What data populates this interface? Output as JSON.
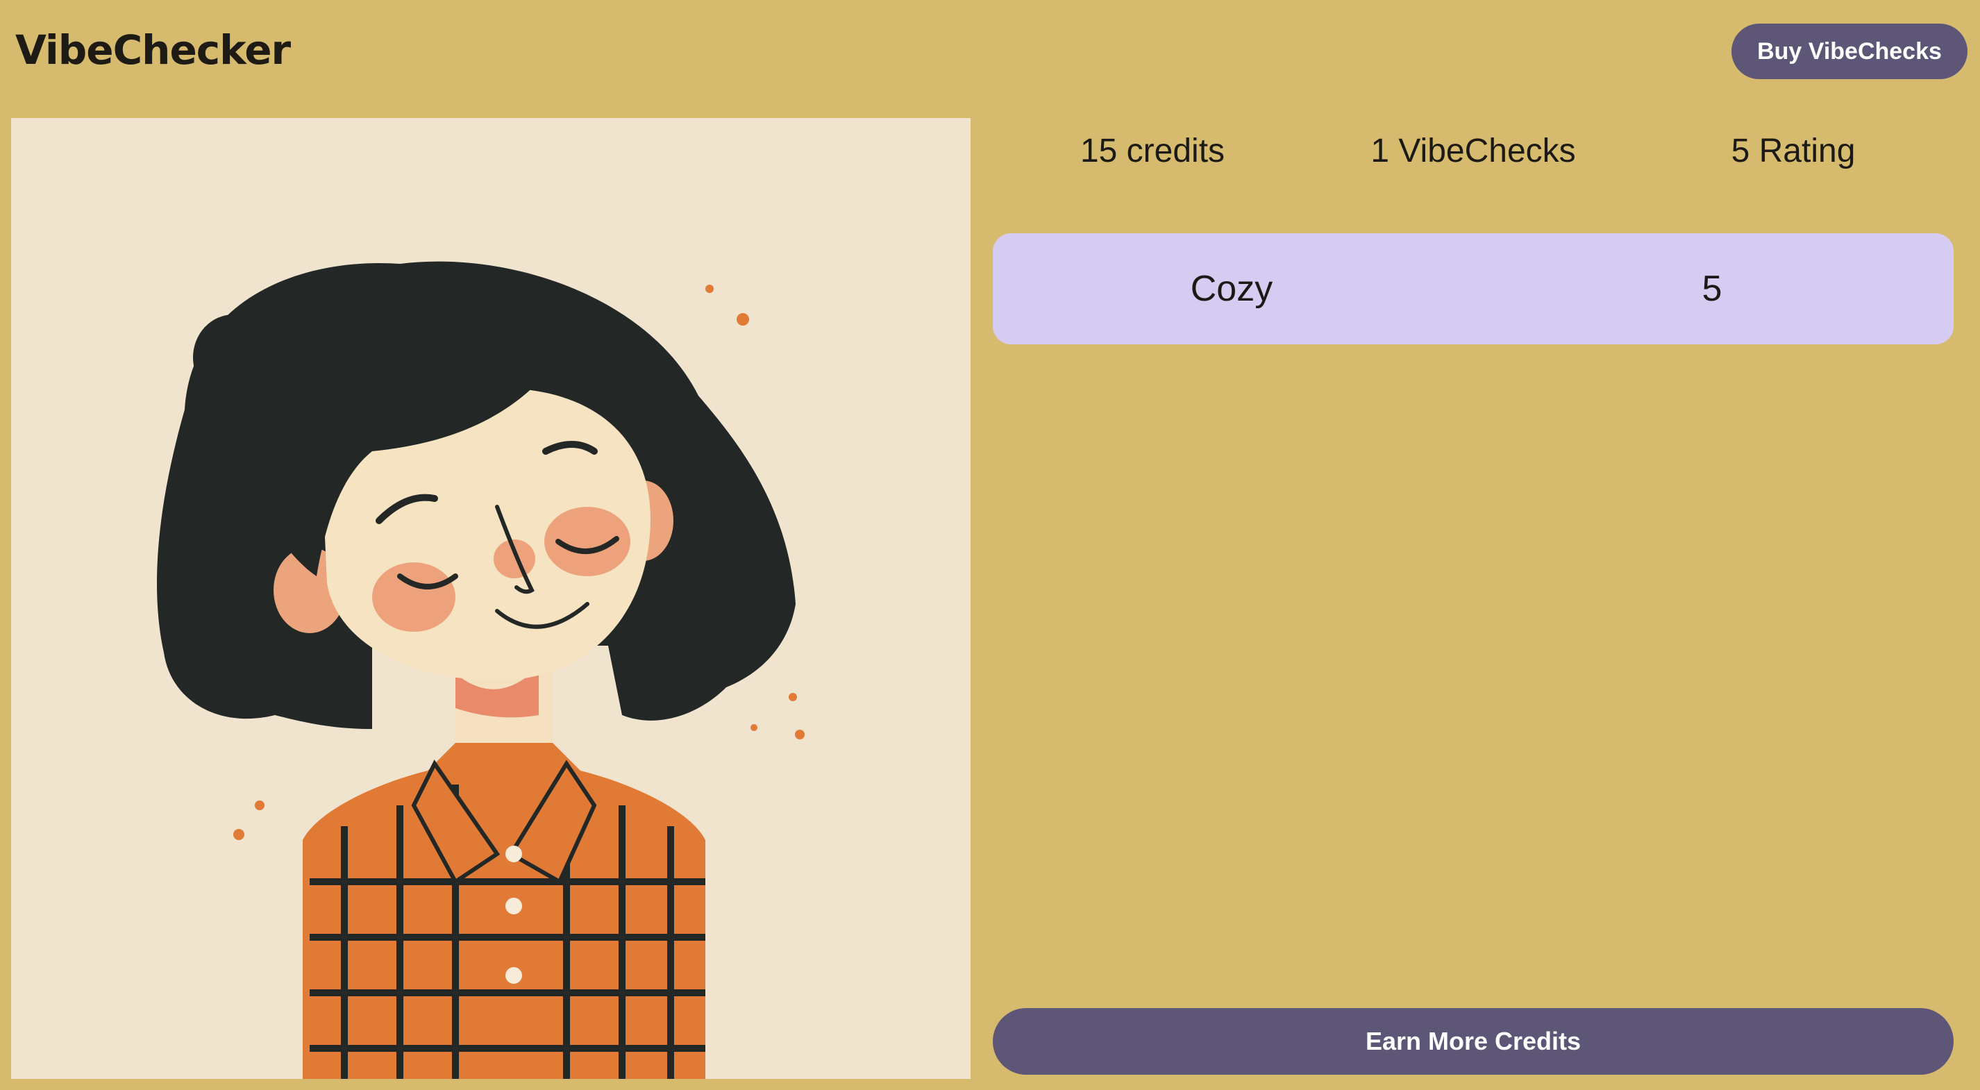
{
  "app": {
    "title": "VibeChecker"
  },
  "header": {
    "buy_label": "Buy VibeChecks"
  },
  "stats": {
    "credits": "15 credits",
    "vibechecks": "1 VibeChecks",
    "rating": "5 Rating"
  },
  "vibes": [
    {
      "name": "Cozy",
      "score": "5"
    }
  ],
  "footer": {
    "earn_label": "Earn More Credits"
  },
  "image": {
    "subject": "illustration-girl-plaid-shirt"
  },
  "colors": {
    "background": "#d6bb6e",
    "button": "#5e5676",
    "vibe_row": "#d6cbf0",
    "image_bg": "#f1e4cf",
    "hair": "#232827",
    "shirt": "#e07a35"
  }
}
